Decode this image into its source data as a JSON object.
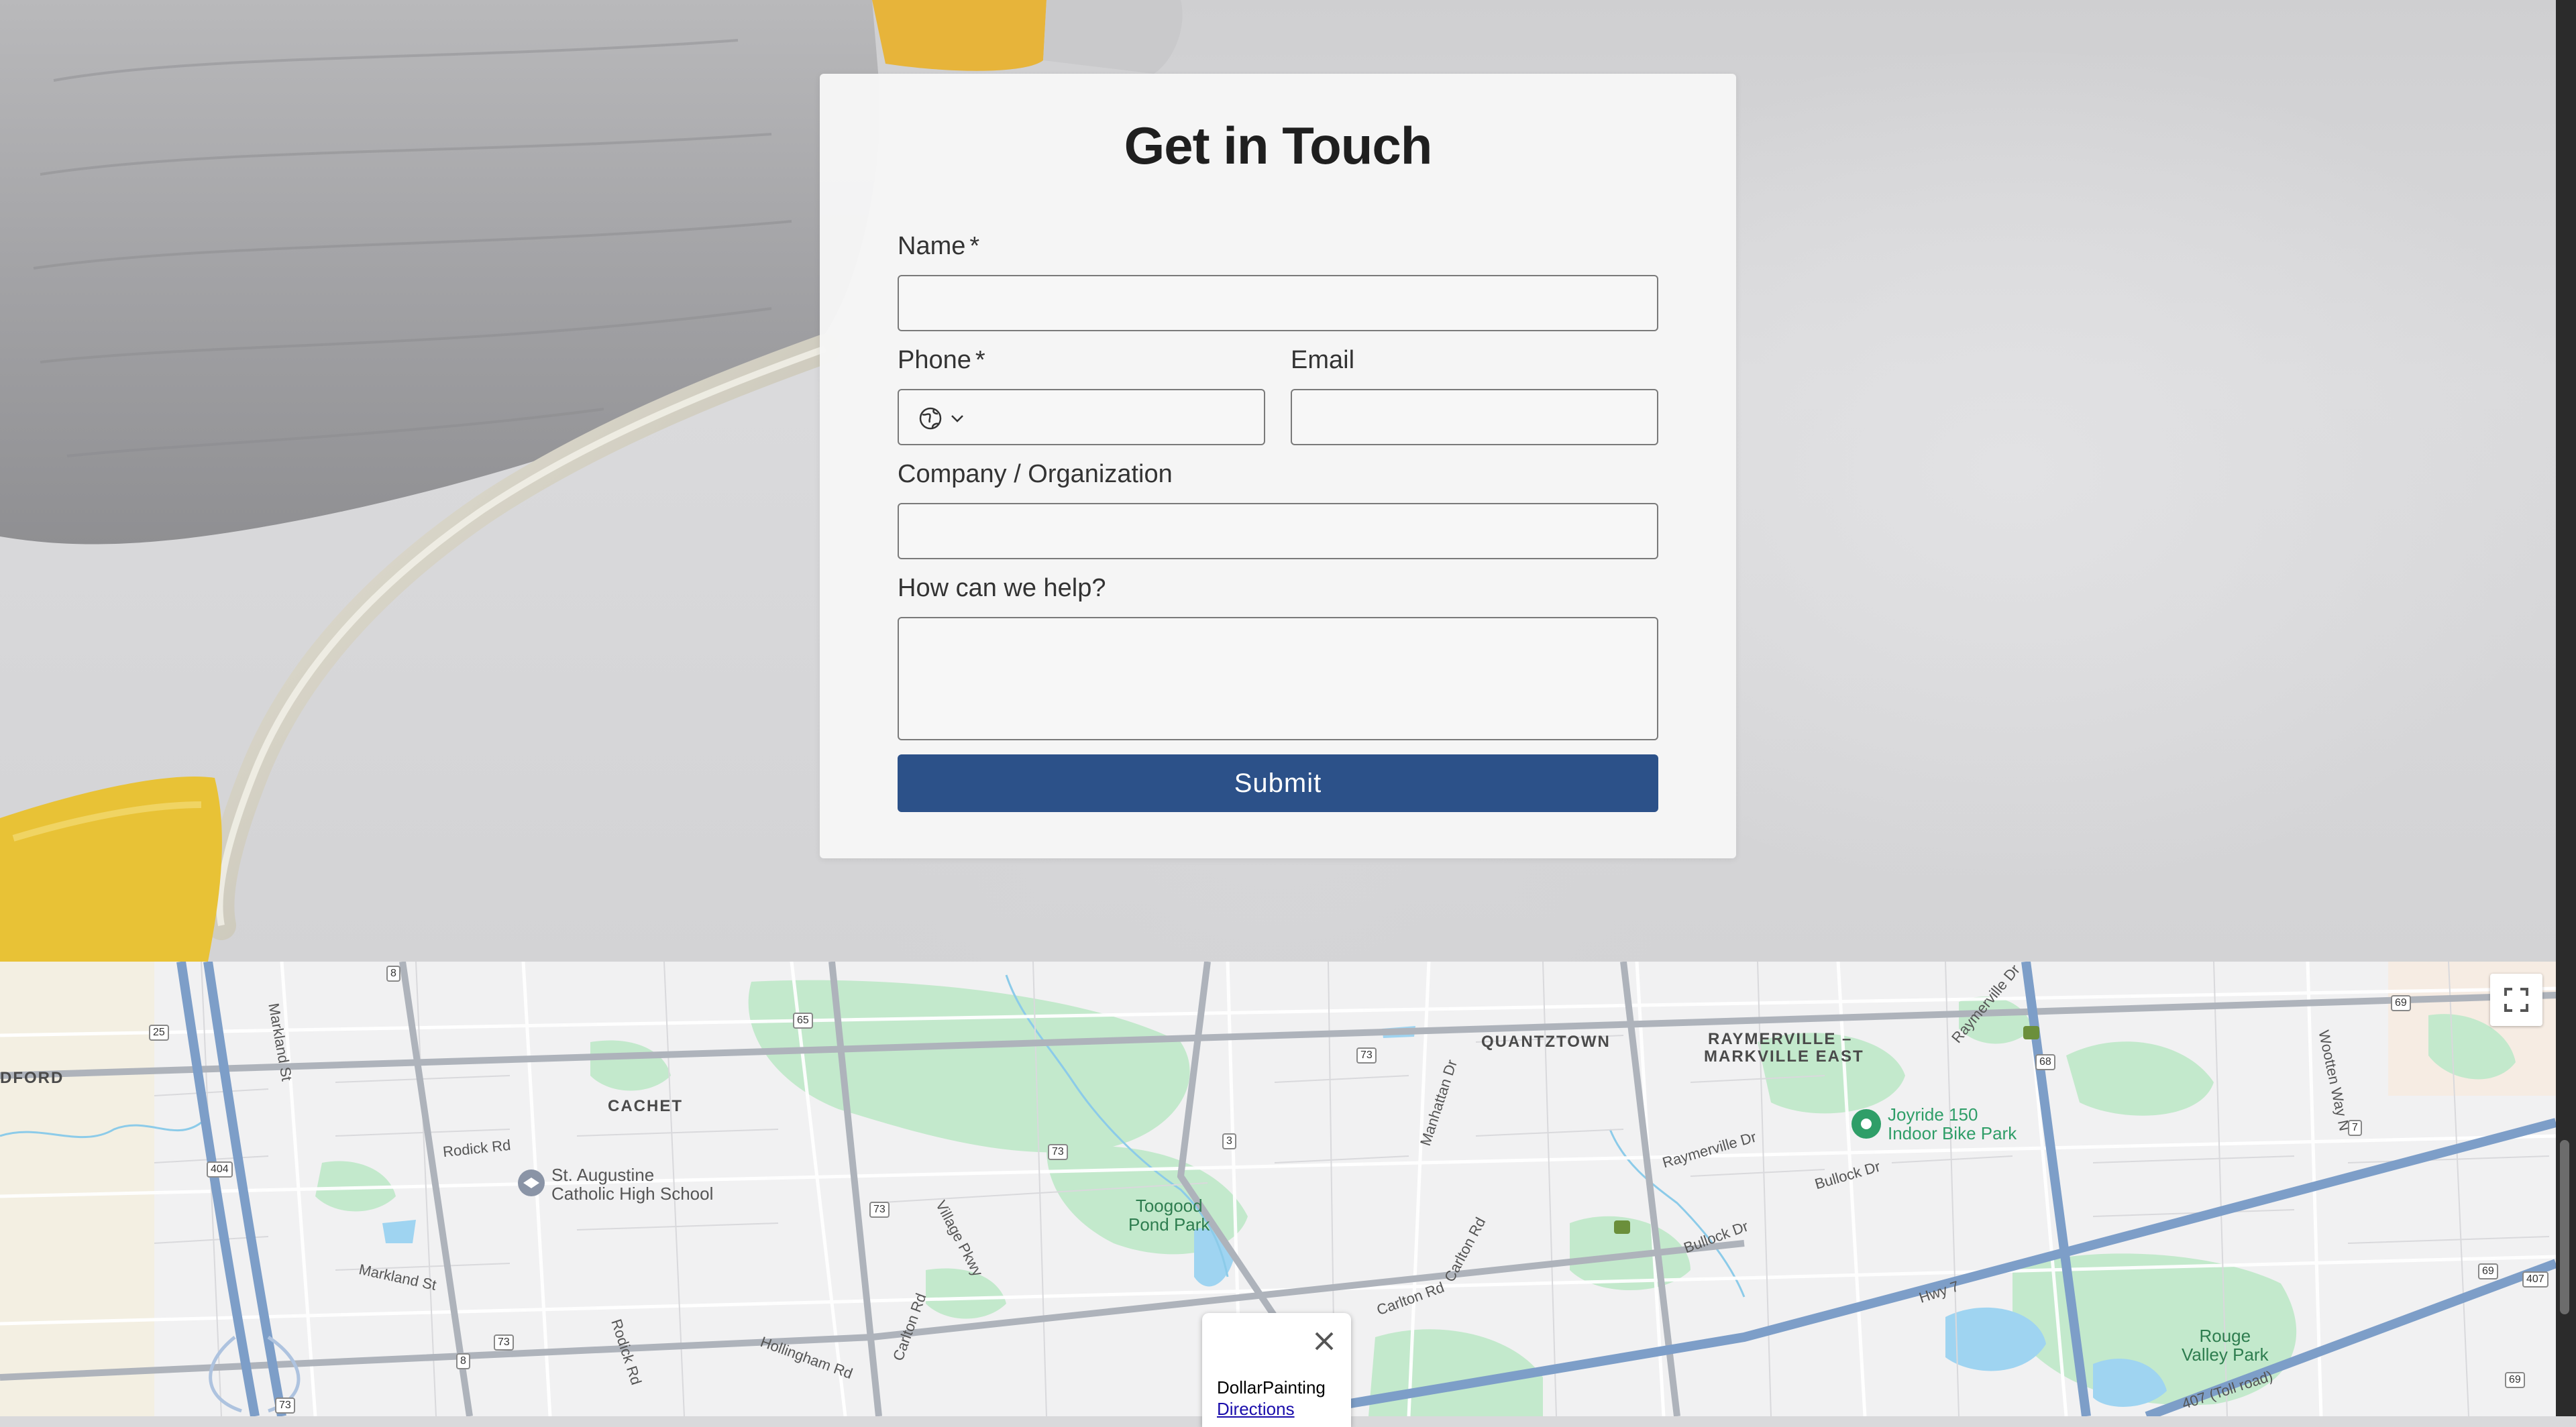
{
  "form": {
    "title": "Get in Touch",
    "name_label": "Name",
    "phone_label": "Phone",
    "email_label": "Email",
    "company_label": "Company / Organization",
    "help_label": "How can we help?",
    "required_mark": "*",
    "submit_label": "Submit"
  },
  "map": {
    "neighbourhoods": {
      "cachet": "CACHET",
      "quantztown": "QUANTZTOWN",
      "raymerville_1": "RAYMERVILLE –",
      "raymerville_2": "MARKVILLE EAST",
      "edge_left": "DFORD"
    },
    "pois": {
      "school_1": "St. Augustine",
      "school_2": "Catholic High School",
      "pond_1": "Toogood",
      "pond_2": "Pond Park",
      "bike_1": "Joyride 150",
      "bike_2": "Indoor Bike Park",
      "rouge_1": "Rouge",
      "rouge_2": "Valley Park"
    },
    "streets": {
      "markland_st": "Markland St",
      "rodick_rd": "Rodick Rd",
      "markland_st_2": "Markland St",
      "rodick_rd_2": "Rodick Rd",
      "hollingham_rd": "Hollingham Rd",
      "carlton_rd": "Carlton Rd",
      "village_pkwy": "Village Pkwy",
      "carlton_rd_2": "Carlton Rd",
      "carlton_rd_3": "Carlton Rd",
      "manhattan_dr": "Manhattan Dr",
      "raymerville_dr": "Raymerville Dr",
      "bullock_dr": "Bullock Dr",
      "bullock_dr_2": "Bullock Dr",
      "hwy7": "Hwy 7",
      "wootten_way": "Wootten Way N",
      "raymerville_dr_2": "Raymerville Dr",
      "toll_road": "407 (Toll road)"
    },
    "shields": {
      "r8": "8",
      "r25": "25",
      "r404": "404",
      "r65": "65",
      "r73a": "73",
      "r73b": "73",
      "r73c": "73",
      "r3": "3",
      "r68": "68",
      "r69a": "69",
      "r69b": "69",
      "r7": "7",
      "r407": "407",
      "r8b": "8",
      "r73d": "73",
      "r73e": "73",
      "r69c": "69"
    },
    "info_window": {
      "title": "DollarPainting",
      "link": "Directions"
    }
  },
  "colors": {
    "submit_bg": "#2c5189",
    "park_green": "#bfe8c8",
    "water_blue": "#9cd2f0",
    "highway_blue": "#7d9ec8"
  },
  "icons": {
    "country_picker": "globe-icon",
    "country_chevron": "chevron-down-icon",
    "fullscreen": "fullscreen-icon",
    "close": "close-icon",
    "school_marker": "school-icon",
    "bike_park_marker": "map-pin-icon"
  }
}
